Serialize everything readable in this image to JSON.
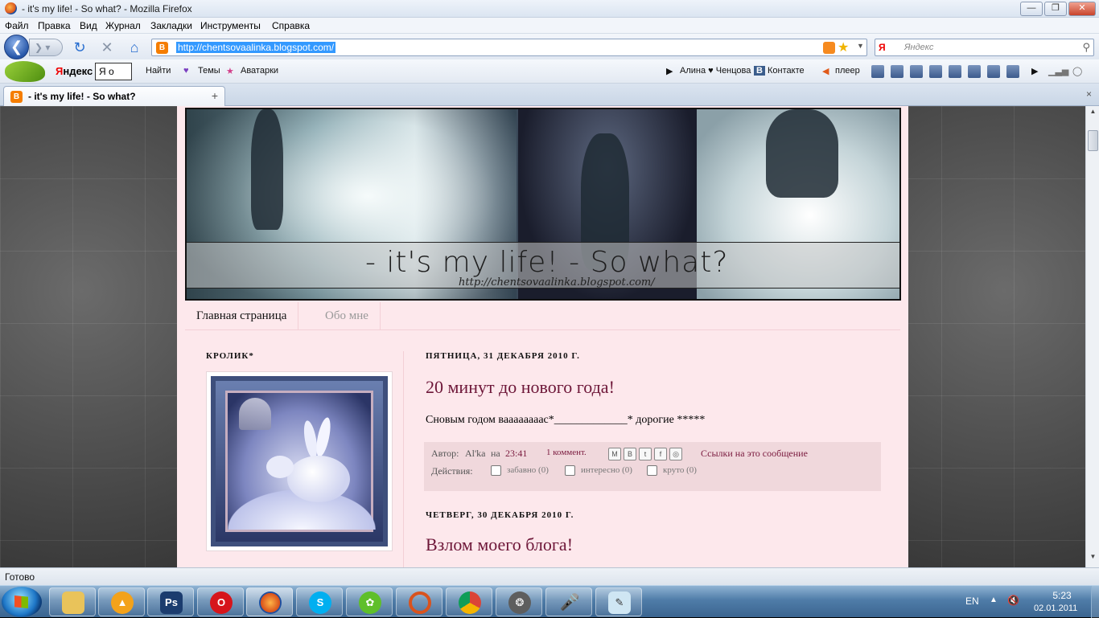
{
  "window": {
    "title": "- it's my life! - So what? - Mozilla Firefox"
  },
  "menu": [
    "Файл",
    "Правка",
    "Вид",
    "Журнал",
    "Закладки",
    "Инструменты",
    "Справка"
  ],
  "nav": {
    "url": "http://chentsovaalinka.blogspot.com/",
    "search_placeholder": "Яндекс",
    "search_engine_glyph": "Я"
  },
  "yandex_bar": {
    "brand": "ндекс",
    "brand_first": "Я",
    "input_value": "Я о",
    "find": "Найти",
    "themes": "Темы",
    "avatars": "Аватарки",
    "user": "Алина ♥ Ченцова",
    "vk": "Контакте",
    "player": "плеер"
  },
  "tab": {
    "label": "- it's my life! - So what?",
    "close": "×",
    "newtab": "+"
  },
  "blog": {
    "header_title": "- it's my life! - So what?",
    "header_url": "http://chentsovaalinka.blogspot.com/",
    "nav": [
      "Главная страница",
      "Обо мне"
    ],
    "sidebar_title": "КРОЛИК*",
    "posts": [
      {
        "date": "ПЯТНИЦА, 31 ДЕКАБРЯ 2010 Г.",
        "title": "20 минут до нового года!",
        "body": "Сновым годом вааааааааc*_____________* дорогие *****",
        "author_label": "Автор:",
        "author": "Al'ka",
        "at": "на",
        "time": "23:41",
        "comments": "1 коммент.",
        "links": "Ссылки на это сообщение",
        "actions_label": "Действия:",
        "reactions": [
          "забавно (0)",
          "интересно (0)",
          "круто (0)"
        ]
      },
      {
        "date": "ЧЕТВЕРГ, 30 ДЕКАБРЯ 2010 Г.",
        "title": "Взлом моего блога!"
      }
    ]
  },
  "status": "Готово",
  "tray": {
    "lang": "EN",
    "time": "5:23",
    "date": "02.01.2011"
  },
  "colors": {
    "blog_bg": "#fde8ec",
    "post_title": "#6d1638",
    "accent_link": "#7a1a3e"
  }
}
